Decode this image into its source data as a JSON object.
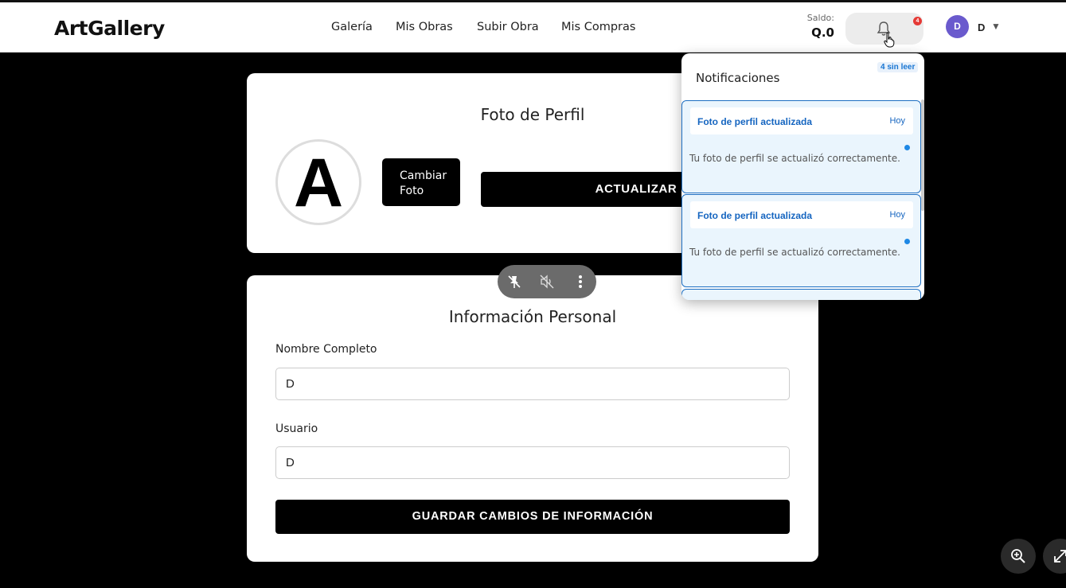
{
  "header": {
    "logo": "ArtGallery",
    "nav": [
      "Galería",
      "Mis Obras",
      "Subir Obra",
      "Mis Compras"
    ],
    "saldo_label": "Saldo:",
    "saldo_value": "Q.0",
    "notif_count": "4",
    "user_initial": "D",
    "user_name": "D",
    "caret": "▼"
  },
  "photo_card": {
    "title": "Foto de Perfil",
    "avatar_letter": "A",
    "change_button": "Cambiar Foto",
    "update_button": "ACTUALIZAR"
  },
  "info_card": {
    "title": "Información Personal",
    "name_label": "Nombre Completo",
    "name_value": "D",
    "user_label": "Usuario",
    "user_value": "D",
    "save_button": "GUARDAR CAMBIOS DE INFORMACIÓN"
  },
  "notifications": {
    "title": "Notificaciones",
    "unread": "4 sin leer",
    "items": [
      {
        "title": "Foto de perfil actualizada",
        "time": "Hoy",
        "message": "Tu foto de perfil se actualizó correctamente."
      },
      {
        "title": "Foto de perfil actualizada",
        "time": "Hoy",
        "message": "Tu foto de perfil se actualizó correctamente."
      }
    ]
  },
  "icons": {
    "bell": "bell-icon",
    "media": [
      "pin-off-icon",
      "volume-off-icon",
      "more-vertical-icon"
    ],
    "zoom": "zoom-in-icon",
    "expand": "expand-icon"
  },
  "colors": {
    "accent": "#1e6fc2",
    "avatar": "#6a5acd",
    "badge": "#e53935"
  }
}
